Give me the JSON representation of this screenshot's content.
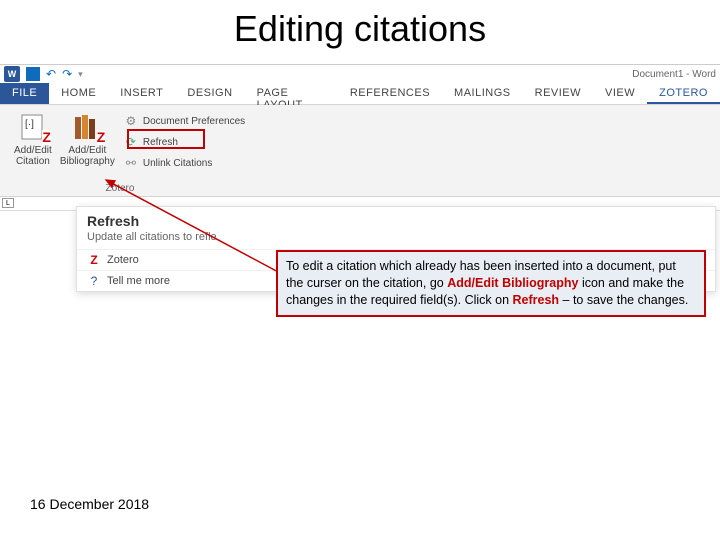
{
  "slide": {
    "title": "Editing citations",
    "date": "16 December 2018"
  },
  "titlebar": {
    "doc_title": "Document1 - Word"
  },
  "tabs": {
    "file": "FILE",
    "home": "HOME",
    "insert": "INSERT",
    "design": "DESIGN",
    "page_layout": "PAGE LAYOUT",
    "references": "REFERENCES",
    "mailings": "MAILINGS",
    "review": "REVIEW",
    "view": "VIEW",
    "zotero": "ZOTERO"
  },
  "ribbon": {
    "add_edit_citation": "Add/Edit\nCitation",
    "add_edit_bibliography": "Add/Edit\nBibliography",
    "doc_prefs": "Document Preferences",
    "refresh": "Refresh",
    "unlink": "Unlink Citations",
    "group": "Zotero"
  },
  "help": {
    "title": "Refresh",
    "desc": "Update all citations to refle",
    "zotero": "Zotero",
    "tell_me": "Tell me more"
  },
  "instruction": {
    "l1": "To edit a citation which already has been inserted into a document, put the curser on the citation, go ",
    "key1": "Add/Edit Bibliography",
    "l2": " icon and make the changes in the required field(s).  Click on ",
    "key2": "Refresh",
    "l3": " – to save the changes."
  }
}
